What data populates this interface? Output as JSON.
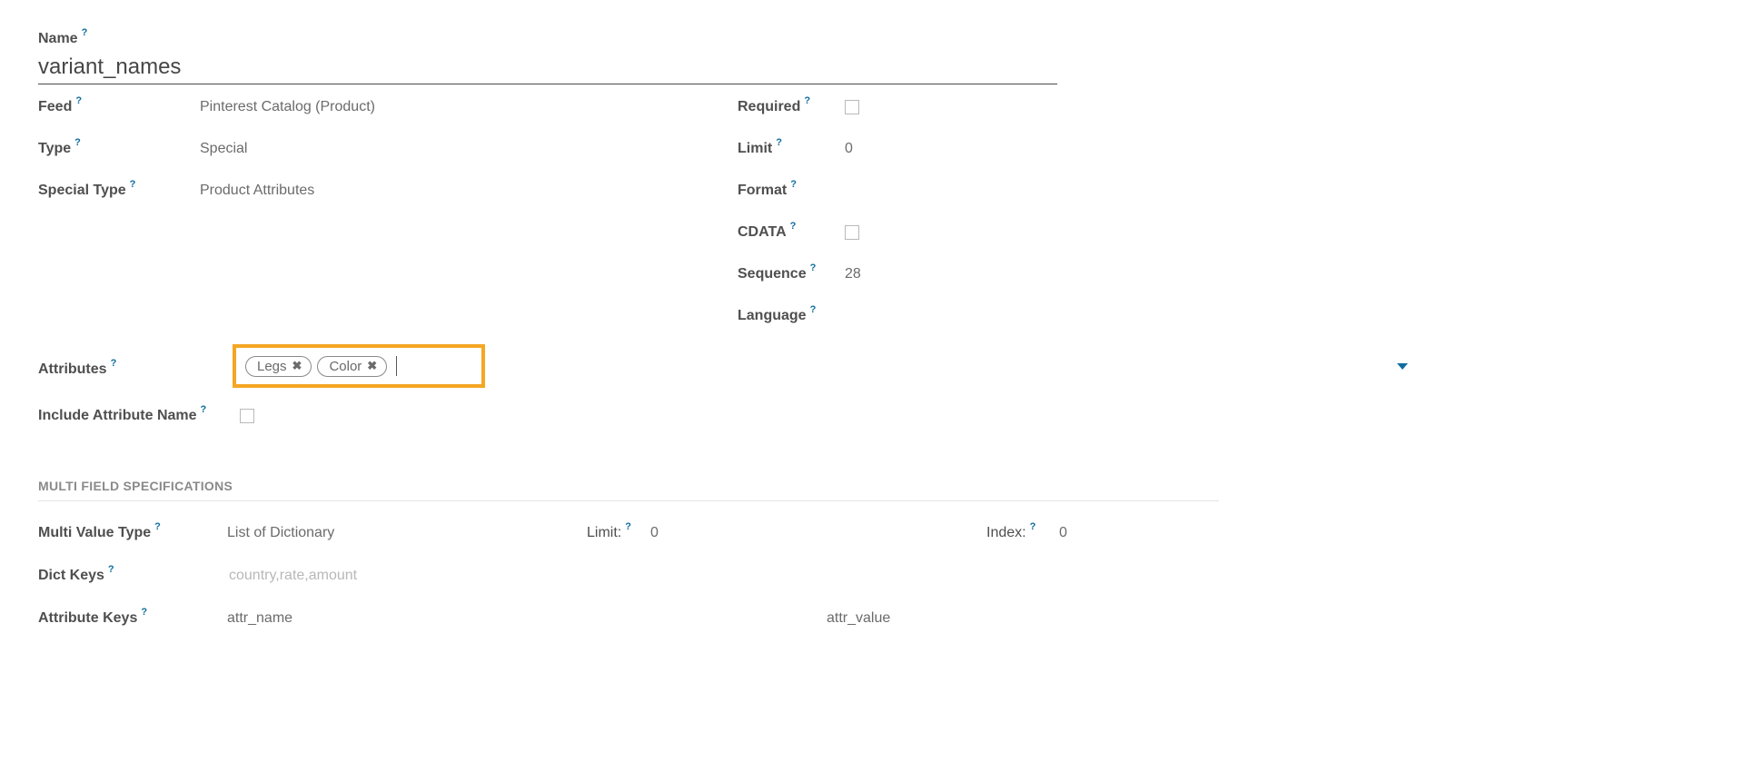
{
  "labels": {
    "name": "Name",
    "feed": "Feed",
    "type": "Type",
    "special_type": "Special Type",
    "required": "Required",
    "limit": "Limit",
    "format": "Format",
    "cdata": "CDATA",
    "sequence": "Sequence",
    "language": "Language",
    "attributes": "Attributes",
    "include_attr_name": "Include Attribute Name",
    "section_multi": "MULTI FIELD SPECIFICATIONS",
    "multi_value_type": "Multi Value Type",
    "limit_colon": "Limit:",
    "index_colon": "Index:",
    "dict_keys": "Dict Keys",
    "attribute_keys": "Attribute Keys"
  },
  "values": {
    "name": "variant_names",
    "feed": "Pinterest Catalog (Product)",
    "type": "Special",
    "special_type": "Product Attributes",
    "required": false,
    "limit": "0",
    "format": "",
    "cdata": false,
    "sequence": "28",
    "language": "",
    "attributes_tags": [
      "Legs",
      "Color"
    ],
    "include_attr_name": false,
    "multi_value_type": "List of Dictionary",
    "multi_limit": "0",
    "multi_index": "0",
    "dict_keys_placeholder": "country,rate,amount",
    "dict_keys_value": "",
    "attr_key_1": "attr_name",
    "attr_key_2": "attr_value"
  },
  "help_char": "?"
}
